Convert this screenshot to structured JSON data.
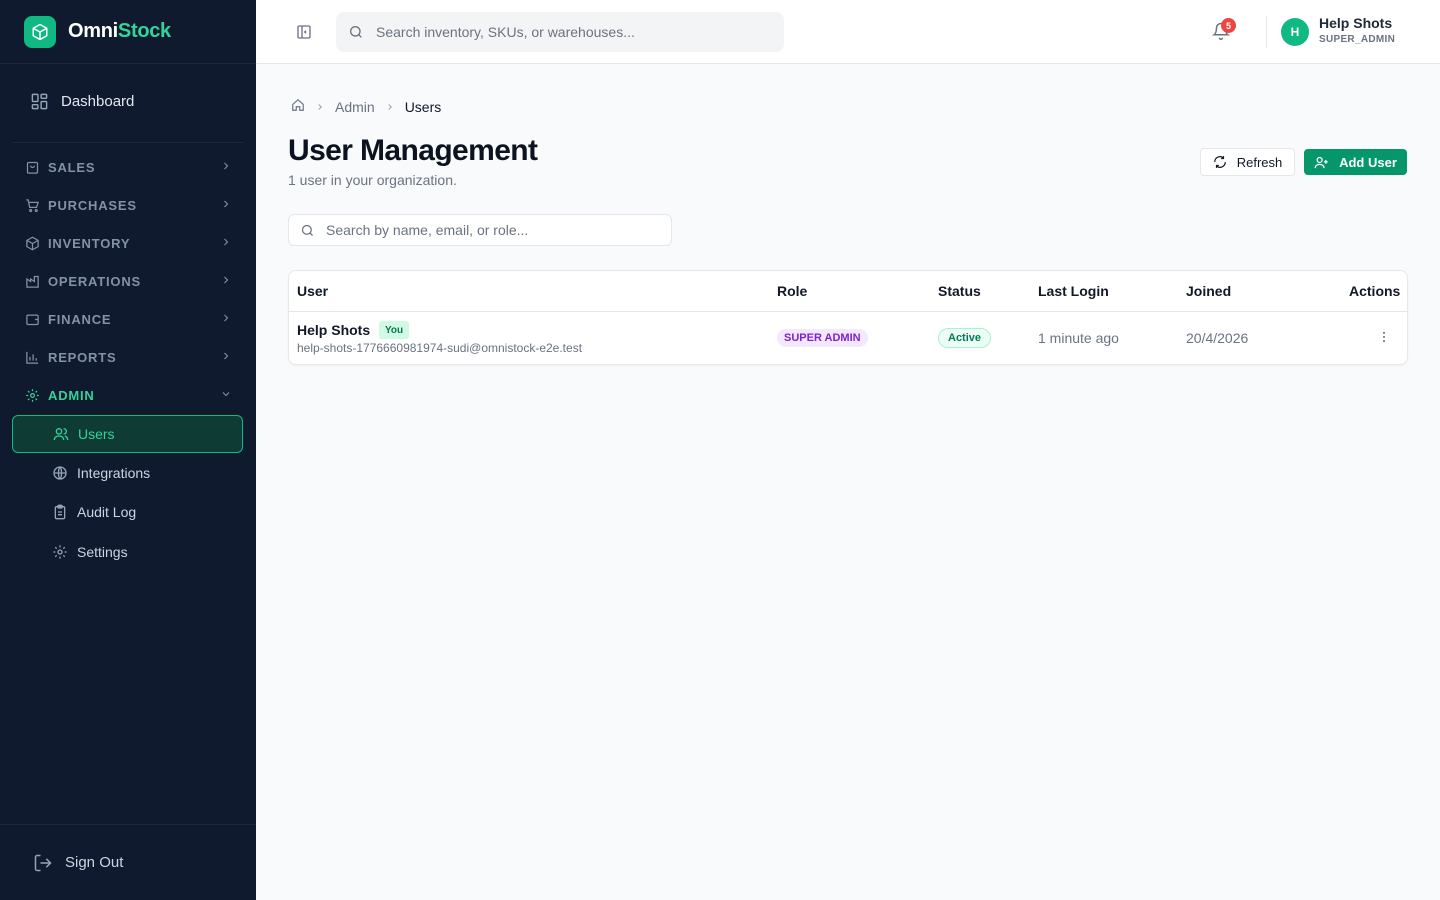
{
  "brand": {
    "name_part1": "Omni",
    "name_part2": "Stock"
  },
  "sidebar": {
    "dashboard_label": "Dashboard",
    "groups": [
      {
        "label": "SALES",
        "icon": "shopping-bag-icon"
      },
      {
        "label": "PURCHASES",
        "icon": "cart-icon"
      },
      {
        "label": "INVENTORY",
        "icon": "box-icon"
      },
      {
        "label": "OPERATIONS",
        "icon": "factory-icon"
      },
      {
        "label": "FINANCE",
        "icon": "wallet-icon"
      },
      {
        "label": "REPORTS",
        "icon": "bar-chart-icon"
      },
      {
        "label": "ADMIN",
        "icon": "gear-icon"
      }
    ],
    "admin_items": [
      {
        "label": "Users",
        "icon": "users-icon"
      },
      {
        "label": "Integrations",
        "icon": "globe-icon"
      },
      {
        "label": "Audit Log",
        "icon": "clipboard-icon"
      },
      {
        "label": "Settings",
        "icon": "gear-icon"
      }
    ],
    "signout_label": "Sign Out"
  },
  "header": {
    "search_placeholder": "Search inventory, SKUs, or warehouses...",
    "notifications_count": "5",
    "user": {
      "initial": "H",
      "name": "Help Shots",
      "role": "SUPER_ADMIN"
    }
  },
  "breadcrumb": {
    "parent": "Admin",
    "current": "Users"
  },
  "page": {
    "title": "User Management",
    "subtitle": "1 user in your organization.",
    "refresh_label": "Refresh",
    "add_user_label": "Add User",
    "search_placeholder": "Search by name, email, or role..."
  },
  "table": {
    "columns": [
      "User",
      "Role",
      "Status",
      "Last Login",
      "Joined",
      "Actions"
    ],
    "rows": [
      {
        "name": "Help Shots",
        "you_badge": "You",
        "email": "help-shots-1776660981974-sudi@omnistock-e2e.test",
        "role": "SUPER ADMIN",
        "status": "Active",
        "last_login": "1 minute ago",
        "joined": "20/4/2026"
      }
    ]
  },
  "colors": {
    "sidebar_bg": "#0f1a2e",
    "accent": "#10b981",
    "primary_button": "#059669",
    "notification_badge": "#ef4444"
  }
}
